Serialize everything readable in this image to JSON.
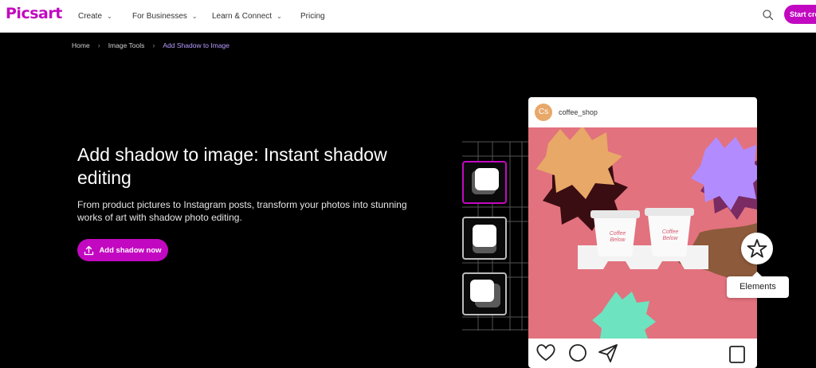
{
  "brand": {
    "logo": "Picsart",
    "accent": "#c209c1"
  },
  "nav": {
    "items": [
      {
        "label": "Create",
        "has_dropdown": true
      },
      {
        "label": "For Businesses",
        "has_dropdown": true
      },
      {
        "label": "Learn & Connect",
        "has_dropdown": true
      },
      {
        "label": "Pricing",
        "has_dropdown": false
      }
    ],
    "search_icon": "search-icon",
    "start_button": "Start cre"
  },
  "breadcrumb": {
    "items": [
      "Home",
      "Image Tools",
      "Add Shadow to Image"
    ]
  },
  "hero": {
    "title": "Add shadow to image: Instant shadow editing",
    "subtitle": "From product pictures to Instagram posts, transform your photos into stunning works of art with shadow photo editing.",
    "cta_label": "Add shadow now",
    "cta_icon": "upload-icon"
  },
  "post": {
    "avatar_text": "Cs",
    "username": "coffee_shop",
    "cup_text": "Coffee Below"
  },
  "elements_tooltip": "Elements",
  "elements_icon": "star-icon",
  "shadow_tiles": [
    {
      "selected": true
    },
    {
      "selected": false
    },
    {
      "selected": false
    }
  ]
}
